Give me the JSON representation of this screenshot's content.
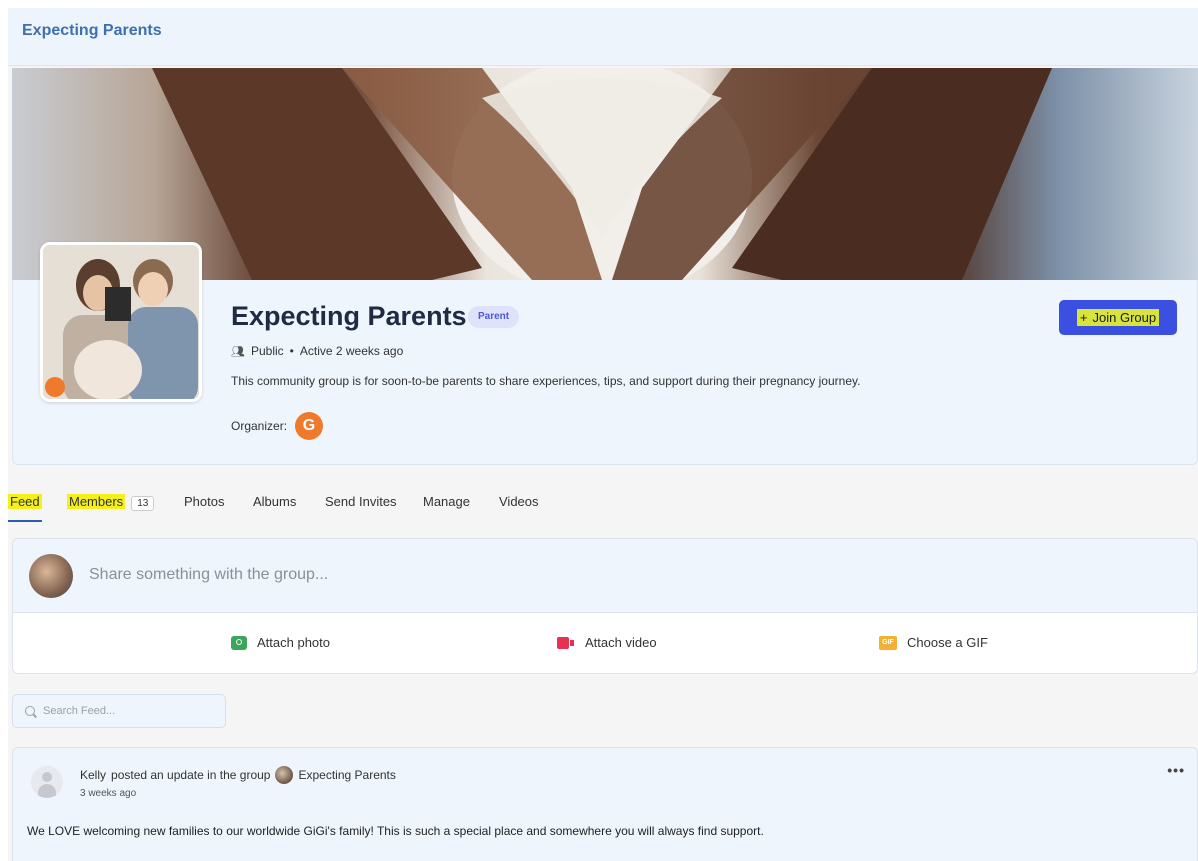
{
  "window": {
    "title": "Expecting Parents"
  },
  "group": {
    "name": "Expecting Parents",
    "badge": "Parent",
    "privacy": "Public",
    "separator": "•",
    "activity": "Active 2 weeks ago",
    "description": "This community group is for soon-to-be parents to share experiences, tips, and support during their pregnancy journey.",
    "organizer_label": "Organizer:",
    "join_label": "Join Group",
    "join_icon": "+"
  },
  "tabs": [
    {
      "label": "Feed",
      "active": true
    },
    {
      "label": "Members",
      "count": "13"
    },
    {
      "label": "Photos"
    },
    {
      "label": "Albums"
    },
    {
      "label": "Send Invites"
    },
    {
      "label": "Manage"
    },
    {
      "label": "Videos"
    }
  ],
  "composer": {
    "placeholder": "Share something with the group...",
    "attach_photo": "Attach photo",
    "attach_video": "Attach video",
    "choose_gif": "Choose a GIF",
    "gif_icon_text": "GIF"
  },
  "search": {
    "placeholder": "Search Feed..."
  },
  "post": {
    "author": "Kelly",
    "action": "posted an update in the group",
    "group": "Expecting Parents",
    "time": "3 weeks ago",
    "body": "We LOVE welcoming new families to our worldwide GiGi's family! This is such a special place and somewhere you will always find support.",
    "more": "•••"
  },
  "colors": {
    "accent": "#3b4fe0",
    "title_blue": "#3f6fb0",
    "organizer_orange": "#f07a2c",
    "highlight": "#f5f01a"
  }
}
